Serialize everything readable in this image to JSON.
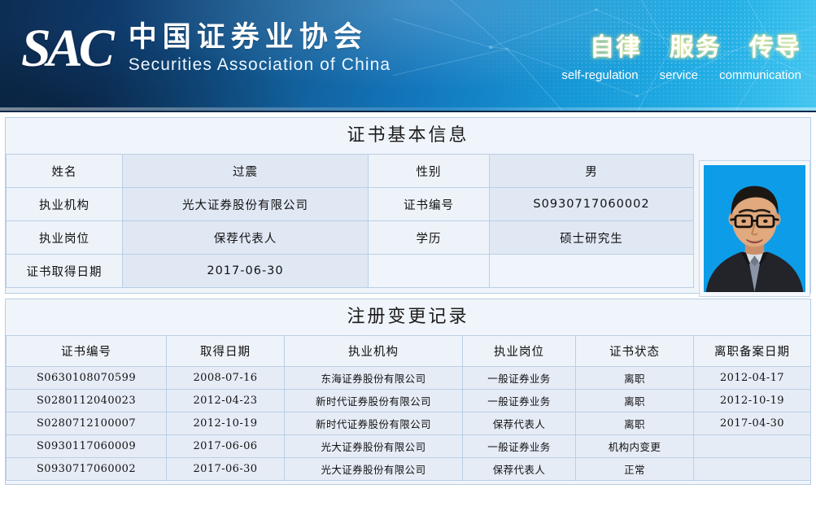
{
  "banner": {
    "logo_mark": "SAC",
    "org_name_cn": "中国证券业协会",
    "org_name_en": "Securities Association of China",
    "slogan_cn": [
      "自律",
      "服务",
      "传导"
    ],
    "slogan_en": [
      "self-regulation",
      "service",
      "communication"
    ],
    "colors": {
      "banner_dark": "#0d2d52",
      "banner_light": "#45c6f0",
      "slogan_glow": "#ffe15a"
    }
  },
  "basic_info": {
    "title": "证书基本信息",
    "rows": [
      {
        "label1": "姓名",
        "value1": "过震",
        "label2": "性别",
        "value2": "男"
      },
      {
        "label1": "执业机构",
        "value1": "光大证券股份有限公司",
        "label2": "证书编号",
        "value2": "S0930717060002"
      },
      {
        "label1": "执业岗位",
        "value1": "保荐代表人",
        "label2": "学历",
        "value2": "硕士研究生"
      },
      {
        "label1": "证书取得日期",
        "value1": "2017-06-30",
        "label2": "",
        "value2": ""
      }
    ],
    "photo_alt": "证件照"
  },
  "records": {
    "title": "注册变更记录",
    "columns": [
      "证书编号",
      "取得日期",
      "执业机构",
      "执业岗位",
      "证书状态",
      "离职备案日期"
    ],
    "rows": [
      [
        "S0630108070599",
        "2008-07-16",
        "东海证券股份有限公司",
        "一般证券业务",
        "离职",
        "2012-04-17"
      ],
      [
        "S0280112040023",
        "2012-04-23",
        "新时代证券股份有限公司",
        "一般证券业务",
        "离职",
        "2012-10-19"
      ],
      [
        "S0280712100007",
        "2012-10-19",
        "新时代证券股份有限公司",
        "保荐代表人",
        "离职",
        "2017-04-30"
      ],
      [
        "S0930117060009",
        "2017-06-06",
        "光大证券股份有限公司",
        "一般证券业务",
        "机构内变更",
        ""
      ],
      [
        "S0930717060002",
        "2017-06-30",
        "光大证券股份有限公司",
        "保荐代表人",
        "正常",
        ""
      ]
    ]
  }
}
